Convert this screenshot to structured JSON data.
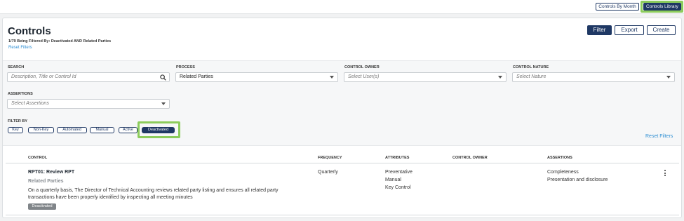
{
  "view_toggle": {
    "by_month": "Controls By Month",
    "library": "Controls Library"
  },
  "header": {
    "title": "Controls",
    "filter_summary": "1/79 Being Filtered By: Deactivated AND Related Parties",
    "reset_filters": "Reset Filters"
  },
  "actions": {
    "filter": "Filter",
    "export": "Export",
    "create": "Create"
  },
  "filters": {
    "search": {
      "label": "SEARCH",
      "placeholder": "Description, Title or Control Id"
    },
    "process": {
      "label": "PROCESS",
      "value": "Related Parties"
    },
    "control_owner": {
      "label": "CONTROL OWNER",
      "placeholder": "Select User(s)"
    },
    "control_nature": {
      "label": "CONTROL NATURE",
      "placeholder": "Select Nature"
    },
    "assertions": {
      "label": "ASSERTIONS",
      "placeholder": "Select Assertions"
    },
    "filter_by": {
      "label": "FILTER BY",
      "chips": [
        "Key",
        "Non-Key",
        "Automated",
        "Manual",
        "Active",
        "Deactivated"
      ],
      "active_chip": "Deactivated"
    },
    "reset_filters": "Reset Filters"
  },
  "table": {
    "columns": [
      "CONTROL",
      "FREQUENCY",
      "ATTRIBUTES",
      "CONTROL OWNER",
      "ASSERTIONS"
    ],
    "rows": [
      {
        "title": "RPT01: Review RPT",
        "process": "Related Parties",
        "description_line1": "On a quarterly basis, The Director of Technical Accounting reviews related party listing and ensures all related party",
        "description_line2": "transactions have been properly identified by inspecting all meeting minutes",
        "status": "Deactivated",
        "frequency": "Quarterly",
        "attributes": [
          "Preventative",
          "Manual",
          "Key Control"
        ],
        "control_owner": "",
        "assertions": [
          "Completeness",
          "Presentation and disclosure"
        ]
      }
    ]
  },
  "colors": {
    "navy": "#1f3864",
    "highlight": "#8ccc5c",
    "link": "#2f8fd3",
    "badge": "#808589"
  }
}
